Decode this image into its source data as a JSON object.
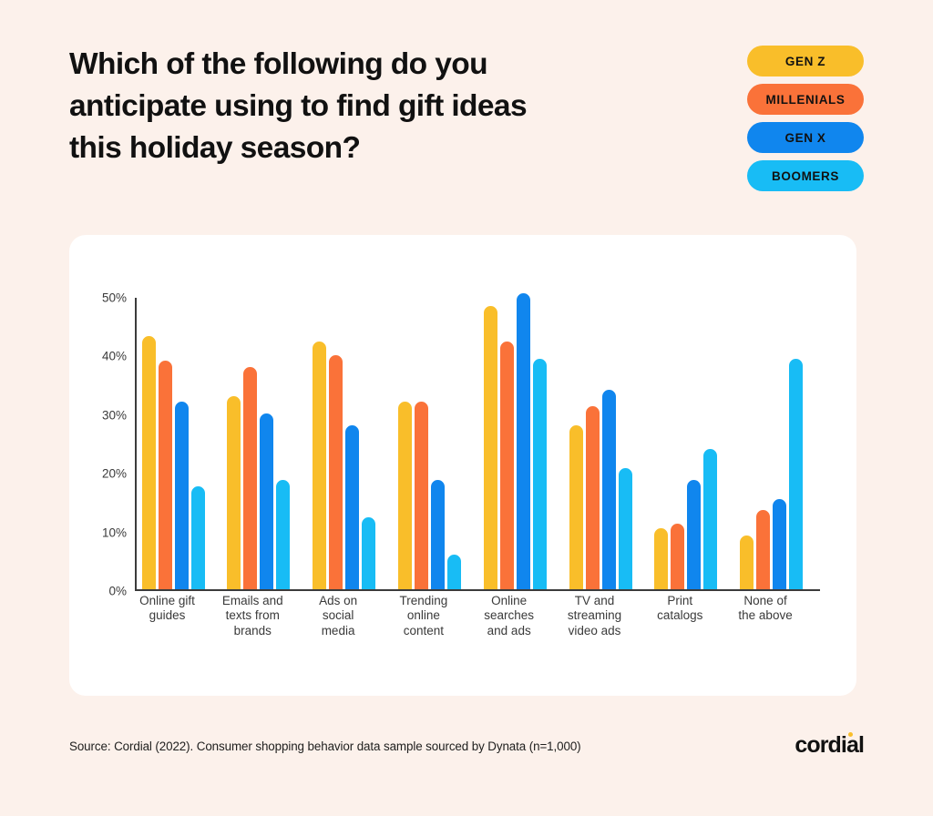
{
  "title": "Which of the following do you anticipate using to find gift ideas this holiday season?",
  "legend": {
    "items": [
      {
        "label": "GEN Z",
        "color": "#F9BE2A"
      },
      {
        "label": "MILLENIALS",
        "color": "#FA7239"
      },
      {
        "label": "GEN X",
        "color": "#1086EE"
      },
      {
        "label": "BOOMERS",
        "color": "#18BCF5"
      }
    ]
  },
  "footer": {
    "source": "Source: Cordial (2022). Consumer shopping behavior data sample sourced by Dynata (n=1,000)",
    "logo_text_1": "cordia",
    "logo_text_2": "l"
  },
  "chart_data": {
    "type": "bar",
    "title": "Which of the following do you anticipate using to find gift ideas this holiday season?",
    "xlabel": "",
    "ylabel": "",
    "ylim": [
      0,
      50
    ],
    "yticks": [
      "0%",
      "10%",
      "20%",
      "30%",
      "40%",
      "50%"
    ],
    "ytick_values": [
      0,
      10,
      20,
      30,
      40,
      50
    ],
    "grid": false,
    "legend_position": "top-right",
    "categories": [
      "Online gift guides",
      "Emails and texts from brands",
      "Ads on social media",
      "Trending online content",
      "Online searches and ads",
      "TV and streaming video ads",
      "Print catalogs",
      "None of the above"
    ],
    "category_lines": [
      [
        "Online gift",
        "guides"
      ],
      [
        "Emails and",
        "texts from",
        "brands"
      ],
      [
        "Ads on",
        "social",
        "media"
      ],
      [
        "Trending",
        "online",
        "content"
      ],
      [
        "Online",
        "searches",
        "and ads"
      ],
      [
        "TV and",
        "streaming",
        "video ads"
      ],
      [
        "Print",
        "catalogs"
      ],
      [
        "None of",
        "the above"
      ]
    ],
    "series": [
      {
        "name": "GEN Z",
        "color": "#F9BE2A",
        "values": [
          43.3,
          33.0,
          42.3,
          32.0,
          48.3,
          28.0,
          10.4,
          9.3
        ]
      },
      {
        "name": "MILLENIALS",
        "color": "#FA7239",
        "values": [
          39.0,
          38.0,
          40.0,
          32.0,
          42.3,
          31.3,
          11.3,
          13.5
        ]
      },
      {
        "name": "GEN X",
        "color": "#1086EE",
        "values": [
          32.0,
          30.0,
          28.0,
          18.7,
          50.6,
          34.0,
          18.7,
          15.5
        ]
      },
      {
        "name": "BOOMERS",
        "color": "#18BCF5",
        "values": [
          17.6,
          18.7,
          12.3,
          6.0,
          39.3,
          20.7,
          24.0,
          39.3
        ]
      }
    ]
  }
}
